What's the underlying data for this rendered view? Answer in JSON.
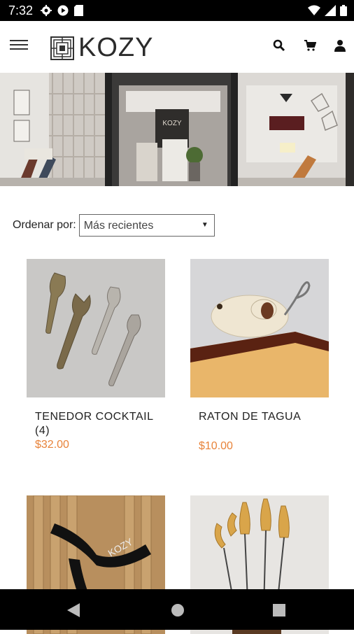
{
  "status_bar": {
    "time": "7:32",
    "icons": [
      "settings-icon",
      "play-icon",
      "sim-card-icon"
    ],
    "right_icons": [
      "wifi-icon",
      "signal-icon",
      "battery-icon"
    ]
  },
  "app_bar": {
    "brand": "KOZY",
    "icons": [
      "menu-icon",
      "search-icon",
      "cart-icon",
      "account-icon"
    ]
  },
  "sort": {
    "label": "Ordenar por:",
    "selected": "Más recientes"
  },
  "products": [
    {
      "name": "TENEDOR COCKTAIL (4)",
      "price": "$32.00"
    },
    {
      "name": "RATON DE TAGUA",
      "price": "$10.00"
    },
    {
      "name": "",
      "price": ""
    },
    {
      "name": "",
      "price": ""
    }
  ],
  "colors": {
    "price": "#e8833a",
    "status_bar": "#000000",
    "nav_bar": "#000000"
  },
  "nav_bar": {
    "icons": [
      "back-icon",
      "home-icon",
      "recents-icon"
    ]
  }
}
